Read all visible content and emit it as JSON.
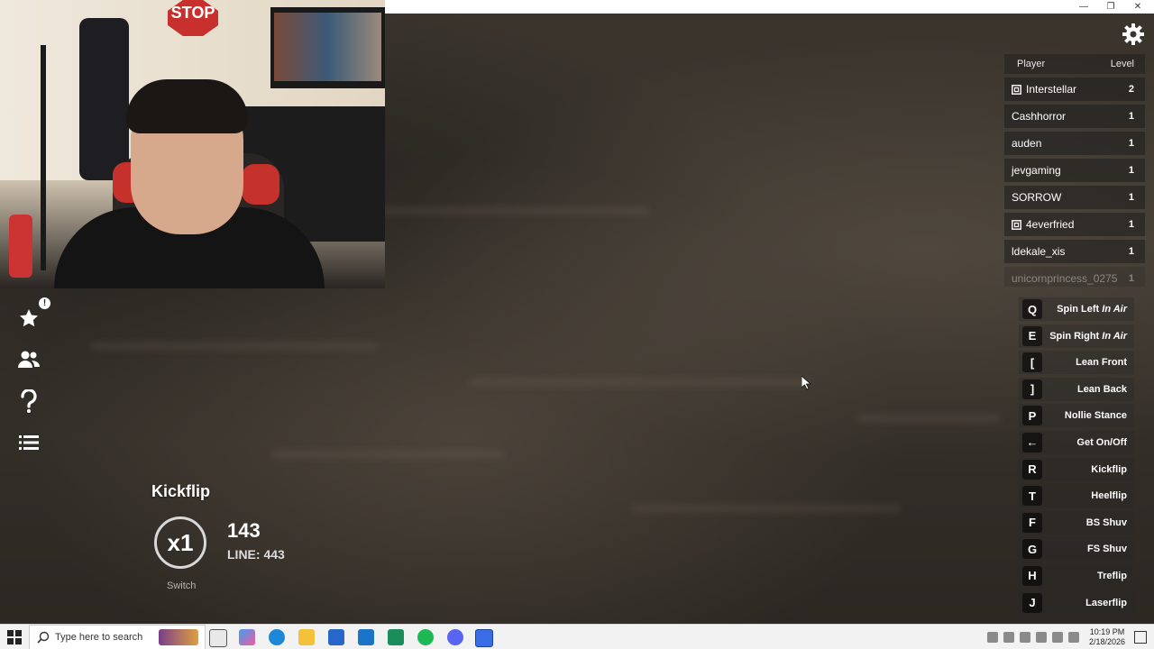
{
  "window": {
    "minimize": "—",
    "maximize": "❐",
    "close": "✕"
  },
  "webcam": {
    "stop_sign": "STOP"
  },
  "left_menu": {
    "notification_badge": "!",
    "items": [
      "favorites",
      "friends",
      "help",
      "menu"
    ]
  },
  "player_list": {
    "header_player": "Player",
    "header_level": "Level",
    "players": [
      {
        "name": "Interstellar",
        "level": "2",
        "has_icon": true
      },
      {
        "name": "Cashhorror",
        "level": "1",
        "has_icon": false
      },
      {
        "name": "auden",
        "level": "1",
        "has_icon": false
      },
      {
        "name": "jevgaming",
        "level": "1",
        "has_icon": false
      },
      {
        "name": "SORROW",
        "level": "1",
        "has_icon": false
      },
      {
        "name": "4everfried",
        "level": "1",
        "has_icon": true
      },
      {
        "name": "ldekale_xis",
        "level": "1",
        "has_icon": false
      },
      {
        "name": "unicornprincess_0275",
        "level": "1",
        "has_icon": false
      }
    ]
  },
  "controls": [
    {
      "key": "Q",
      "label": "Spin Left",
      "suffix": "In Air"
    },
    {
      "key": "E",
      "label": "Spin Right",
      "suffix": "In Air"
    },
    {
      "key": "[",
      "label": "Lean Front",
      "suffix": ""
    },
    {
      "key": "]",
      "label": "Lean Back",
      "suffix": ""
    },
    {
      "key": "P",
      "label": "Nollie Stance",
      "suffix": ""
    },
    {
      "key": "←",
      "label": "Get On/Off",
      "suffix": ""
    },
    {
      "key": "R",
      "label": "Kickflip",
      "suffix": ""
    },
    {
      "key": "T",
      "label": "Heelflip",
      "suffix": ""
    },
    {
      "key": "F",
      "label": "BS Shuv",
      "suffix": ""
    },
    {
      "key": "G",
      "label": "FS Shuv",
      "suffix": ""
    },
    {
      "key": "H",
      "label": "Treflip",
      "suffix": ""
    },
    {
      "key": "J",
      "label": "Laserflip",
      "suffix": ""
    }
  ],
  "hud": {
    "trick_name": "Kickflip",
    "multiplier": "x1",
    "score": "143",
    "line_score": "LINE: 443",
    "stance": "Switch"
  },
  "taskbar": {
    "search_placeholder": "Type here to search",
    "time": "10:19 PM",
    "date": "2/18/2026"
  }
}
